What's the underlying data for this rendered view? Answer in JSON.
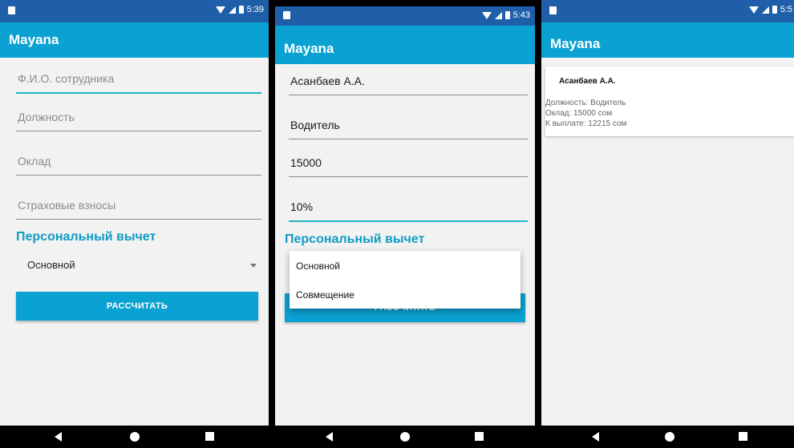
{
  "screens": [
    {
      "status": {
        "time": "5:39"
      },
      "app_title": "Mayana",
      "fields": [
        {
          "value": "",
          "placeholder": "Ф.И.О. сотрудника"
        },
        {
          "value": "",
          "placeholder": "Должность"
        },
        {
          "value": "",
          "placeholder": "Оклад"
        },
        {
          "value": "",
          "placeholder": "Страховые взносы"
        }
      ],
      "section_label": "Персональный вычет",
      "select_value": "Основной",
      "button_label": "РАССЧИТАТЬ"
    },
    {
      "status": {
        "time": "5:43"
      },
      "app_title": "Mayana",
      "fields": [
        {
          "value": "Асанбаев А.А.",
          "placeholder": ""
        },
        {
          "value": "Водитель",
          "placeholder": ""
        },
        {
          "value": "15000",
          "placeholder": ""
        },
        {
          "value": "10%",
          "placeholder": ""
        }
      ],
      "section_label": "Персональный вычет",
      "dropdown_options": [
        "Основной",
        "Совмещение"
      ],
      "button_label": "РАССЧИТАТЬ"
    },
    {
      "status": {
        "time": "5:5"
      },
      "app_title": "Mayana",
      "card": {
        "name": "Асанбаев А.А.",
        "position_line": "Должность: Водитель",
        "salary_line": "Оклад: 15000 сом",
        "payout_line": "К выплате: 12215 сом"
      }
    }
  ],
  "colors": {
    "statusbar": "#1f5faa",
    "appbar": "#0aa1d3",
    "accent": "#0f9cc6",
    "field_focus": "#1cb7c6"
  },
  "icons": {
    "status": [
      "wifi-icon",
      "signal-icon",
      "battery-icon"
    ],
    "nav": [
      "back-icon",
      "home-icon",
      "recent-apps-icon"
    ]
  }
}
